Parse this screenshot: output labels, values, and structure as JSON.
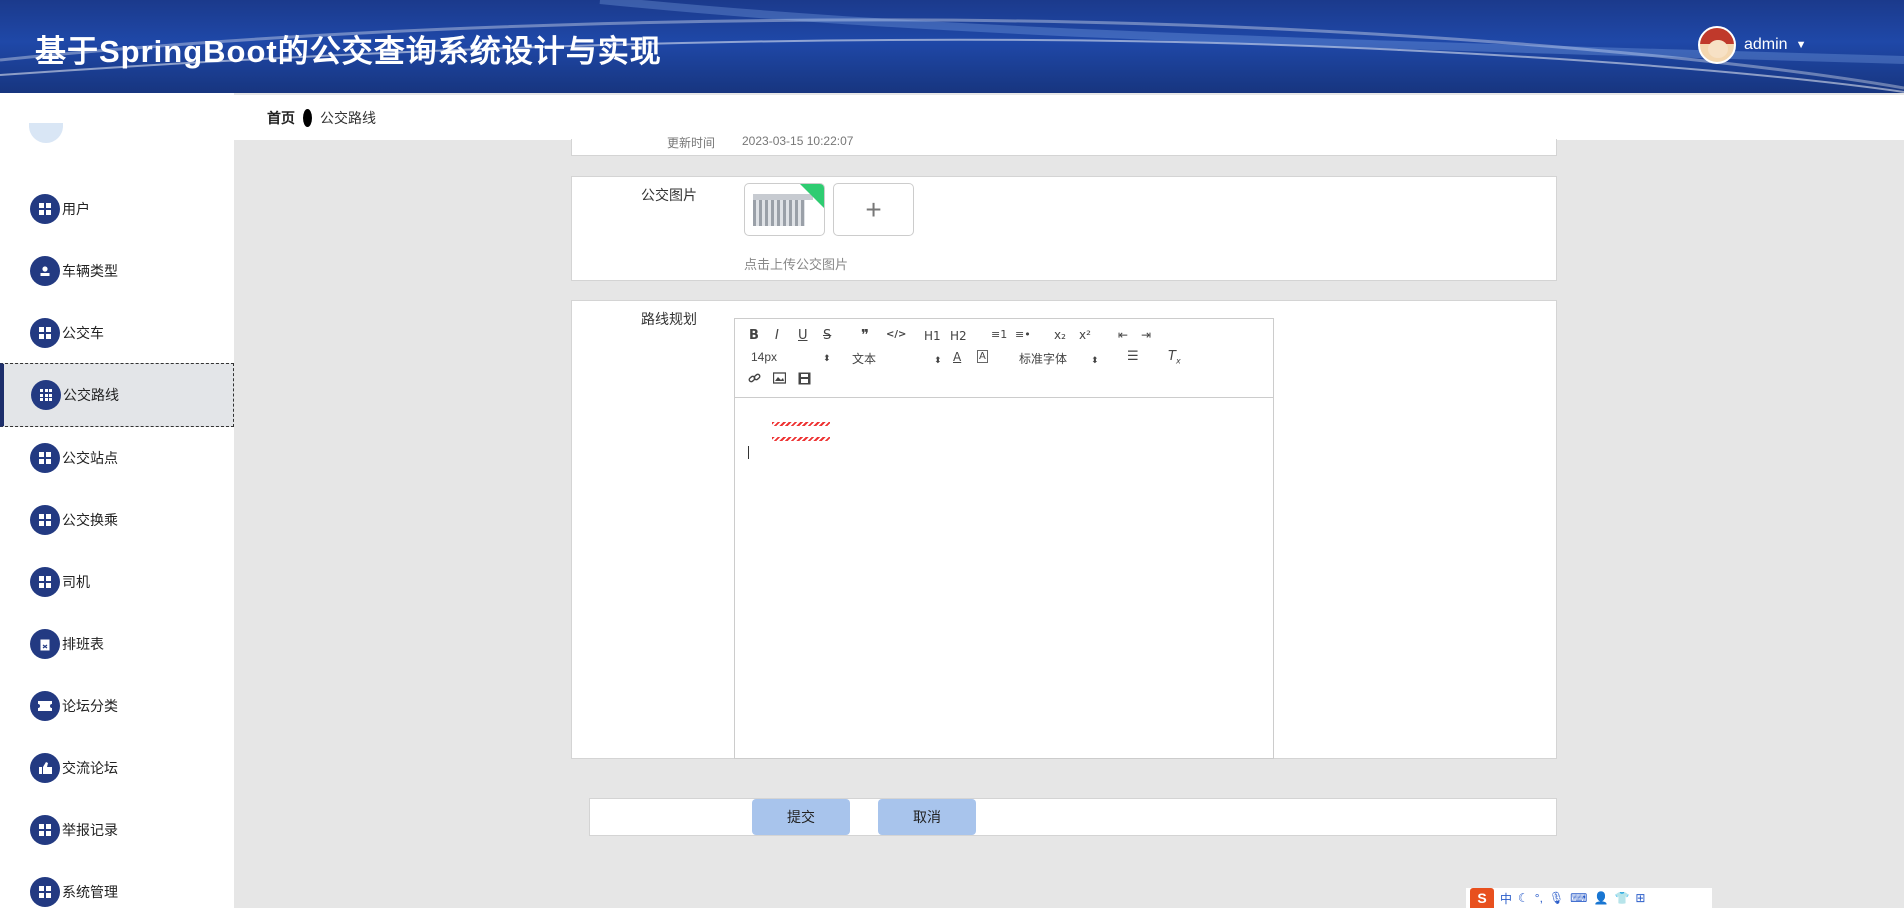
{
  "header": {
    "title": "基于SpringBoot的公交查询系统设计与实现",
    "username": "admin"
  },
  "breadcrumb": {
    "home": "首页",
    "current": "公交路线"
  },
  "sidebar": {
    "items": [
      {
        "label": "用户",
        "icon": "grid-icon"
      },
      {
        "label": "车辆类型",
        "icon": "user-icon"
      },
      {
        "label": "公交车",
        "icon": "grid-icon"
      },
      {
        "label": "公交路线",
        "icon": "grid9-icon",
        "active": true
      },
      {
        "label": "公交站点",
        "icon": "grid-icon"
      },
      {
        "label": "公交换乘",
        "icon": "grid-icon"
      },
      {
        "label": "司机",
        "icon": "grid-icon"
      },
      {
        "label": "排班表",
        "icon": "clipboard-icon"
      },
      {
        "label": "论坛分类",
        "icon": "ticket-icon"
      },
      {
        "label": "交流论坛",
        "icon": "thumb-icon"
      },
      {
        "label": "举报记录",
        "icon": "grid-icon"
      },
      {
        "label": "系统管理",
        "icon": "grid-icon"
      }
    ]
  },
  "form": {
    "partial_row": {
      "label_fragment": "更新时间",
      "value": "2023-03-15 10:22:07"
    },
    "image_field": {
      "label": "公交图片",
      "hint": "点击上传公交图片",
      "upload_symbol": "+"
    },
    "route_field": {
      "label": "路线规划"
    }
  },
  "editor": {
    "toolbar_row1": [
      "B",
      "I",
      "U",
      "S",
      "❞",
      "</>",
      "H1",
      "H2",
      "≡1",
      "≡•",
      "x₂",
      "x²",
      "⇤",
      "⇥"
    ],
    "font_size": "14px",
    "block_format": "文本",
    "font_family": "标准字体",
    "toolbar_row3": [
      "link",
      "image",
      "video"
    ]
  },
  "actions": {
    "submit": "提交",
    "cancel": "取消"
  },
  "ime": {
    "logo": "S",
    "lang": "中"
  }
}
